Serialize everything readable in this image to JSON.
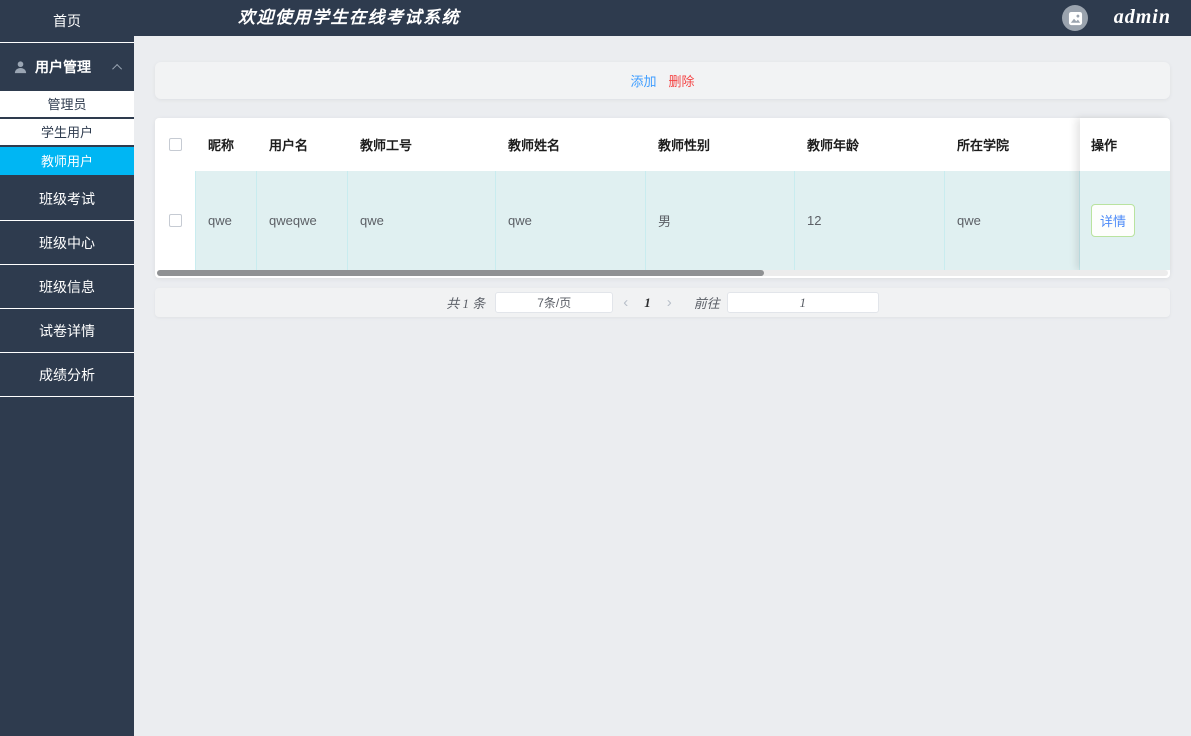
{
  "app": {
    "title": "欢迎使用学生在线考试系统",
    "user": "admin"
  },
  "sidebar": {
    "home_label": "首页",
    "user_mgmt_label": "用户管理",
    "submenu": [
      "管理员",
      "学生用户",
      "教师用户"
    ],
    "active_submenu": "教师用户",
    "items": [
      "班级考试",
      "班级中心",
      "班级信息",
      "试卷详情",
      "成绩分析"
    ]
  },
  "toolbar": {
    "add_label": "添加",
    "delete_label": "删除"
  },
  "table": {
    "columns": [
      "昵称",
      "用户名",
      "教师工号",
      "教师姓名",
      "教师性别",
      "教师年龄",
      "所在学院",
      "操作"
    ],
    "rows": [
      {
        "nickname": "qwe",
        "username": "qweqwe",
        "teacher_no": "qwe",
        "teacher_name": "qwe",
        "gender": "男",
        "age": "12",
        "college": "qwe",
        "action_label": "详情"
      }
    ]
  },
  "pagination": {
    "total_text": "共 1 条",
    "page_size": "7条/页",
    "prev_icon": "‹",
    "current_page": "1",
    "next_icon": "›",
    "goto_label": "前往",
    "goto_value": "1"
  },
  "icons": {
    "user_group": "person-icon",
    "collapse": "chevron-up-icon",
    "avatar": "image-placeholder-icon"
  },
  "colors": {
    "sidebar_navy": "#2e3b4e",
    "active_cyan": "#00b6f3",
    "accent_blue": "#409eff",
    "danger_red": "#f44545",
    "row_teal": "#e0f0f1",
    "page_bg": "#ebedf0"
  }
}
